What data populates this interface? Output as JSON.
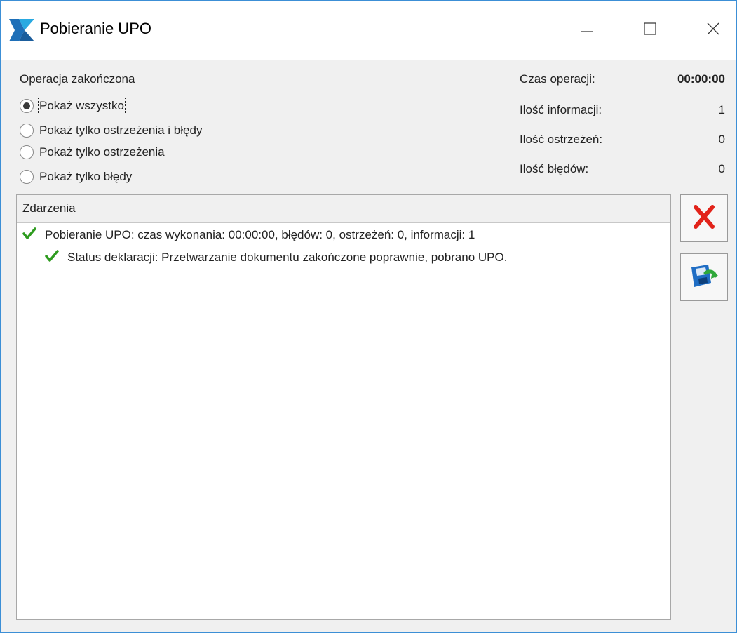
{
  "window": {
    "title": "Pobieranie UPO",
    "icons": {
      "app": "app-logo-icon",
      "minimize": "minimize-icon",
      "maximize": "maximize-icon",
      "close": "close-icon"
    }
  },
  "status": {
    "label": "Operacja zakończona"
  },
  "filters": {
    "selected": 0,
    "options": [
      "Pokaż wszystko",
      "Pokaż tylko ostrzeżenia i błędy",
      "Pokaż tylko ostrzeżenia",
      "Pokaż tylko błędy"
    ]
  },
  "stats": {
    "time_label": "Czas operacji:",
    "time_value": "00:00:00",
    "info_label": "Ilość informacji:",
    "info_value": "1",
    "warnings_label": "Ilość ostrzeżeń:",
    "warnings_value": "0",
    "errors_label": "Ilość błędów:",
    "errors_value": "0"
  },
  "events": {
    "header": "Zdarzenia",
    "rows": [
      {
        "icon": "check-icon",
        "text": "Pobieranie UPO: czas wykonania: 00:00:00, błędów: 0, ostrzeżeń: 0, informacji: 1"
      },
      {
        "icon": "check-icon",
        "text": "Status deklaracji: Przetwarzanie dokumentu zakończone poprawnie, pobrano UPO."
      }
    ]
  },
  "actions": {
    "cancel_icon": "red-x-icon",
    "save_icon": "save-disk-icon"
  },
  "colors": {
    "accent": "#3c8fd6",
    "check": "#2e9b1f",
    "cancel": "#e2231a"
  }
}
